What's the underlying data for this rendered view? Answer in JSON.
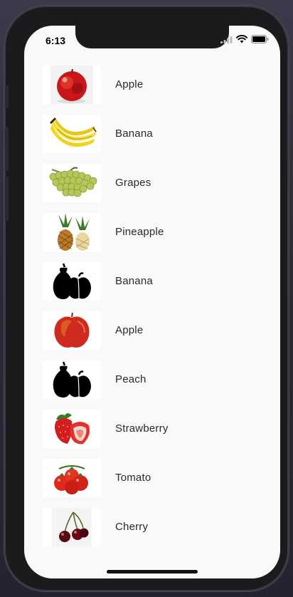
{
  "status_bar": {
    "time": "6:13",
    "icons": [
      "signal-icon",
      "wifi-icon",
      "battery-icon"
    ]
  },
  "list": {
    "items": [
      {
        "label": "Apple",
        "image": "apple-photo"
      },
      {
        "label": "Banana",
        "image": "banana-photo"
      },
      {
        "label": "Grapes",
        "image": "grapes-photo"
      },
      {
        "label": "Pineapple",
        "image": "pineapple-photo"
      },
      {
        "label": "Banana",
        "image": "fruit-silhouette-icon"
      },
      {
        "label": "Apple",
        "image": "apple-photo"
      },
      {
        "label": "Peach",
        "image": "fruit-silhouette-icon"
      },
      {
        "label": "Strawberry",
        "image": "strawberry-photo"
      },
      {
        "label": "Tomato",
        "image": "tomato-photo"
      },
      {
        "label": "Cherry",
        "image": "cherry-photo"
      }
    ]
  },
  "colors": {
    "screen_background": "#f9f9f9",
    "label_text": "#2a2a2a",
    "device_frame": "#1b1b1d"
  }
}
